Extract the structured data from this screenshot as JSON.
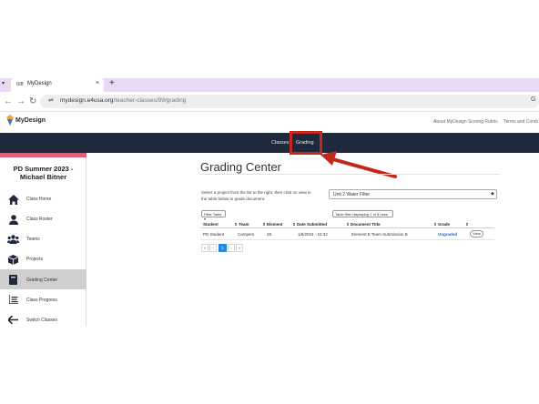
{
  "browser": {
    "tab_title": "MyDesign",
    "tab_favicon": "0/8",
    "tab_dropdown": "▾",
    "tab_close": "×",
    "new_tab": "+",
    "url_domain": "mydesign.e4usa.org",
    "url_path": "/teacher-classes/99/grading",
    "nav_back": "←",
    "nav_forward": "→",
    "nav_reload": "↻",
    "site_info": "⇌",
    "menu_right": "G"
  },
  "site": {
    "logo_text": "MyDesign",
    "top_links": [
      "About MyDesign Scoring Rubric",
      "Terms and Condi"
    ],
    "nav": [
      "Classes",
      "Grading"
    ]
  },
  "sidebar": {
    "title": "PD Summer 2023 - Michael Bitner",
    "items": [
      {
        "label": "Class Home",
        "icon": "home-icon"
      },
      {
        "label": "Class Roster",
        "icon": "person-icon"
      },
      {
        "label": "Teams",
        "icon": "group-icon"
      },
      {
        "label": "Projects",
        "icon": "cube-icon"
      },
      {
        "label": "Grading Center",
        "icon": "book-icon",
        "active": true
      },
      {
        "label": "Class Progress",
        "icon": "list-icon"
      },
      {
        "label": "Switch Classes",
        "icon": "arrow-left-icon"
      }
    ]
  },
  "main": {
    "title": "Grading Center",
    "instructions": "Select a project from the list to the right, then click on view in the table below to grade document.",
    "project_select": "Unit 2 Water Filter",
    "filter_button": "Filter Table ▾",
    "filter_status": "Table filter displaying 1 of 8 rows",
    "table": {
      "columns": [
        "Student",
        "Team",
        "Element",
        "Date Submitted",
        "Document Title",
        "Grade"
      ],
      "rows": [
        {
          "student": "PD Student",
          "team": "Campers",
          "element": "2E",
          "date": "1/6/2024 - 15:32",
          "title": "Element E Team Submission B",
          "grade": "Ungraded",
          "action": "View"
        }
      ]
    },
    "pagination": [
      "«",
      "‹",
      "1",
      "›",
      "»"
    ],
    "current_page": "1"
  },
  "colors": {
    "navbar": "#1e2a3b",
    "annotation": "#c4281c",
    "sidebar_accent": "#e0607c",
    "link_blue": "#2a63c4",
    "active_page": "#2c86d6",
    "tabstrip": "#e8d9f4"
  }
}
